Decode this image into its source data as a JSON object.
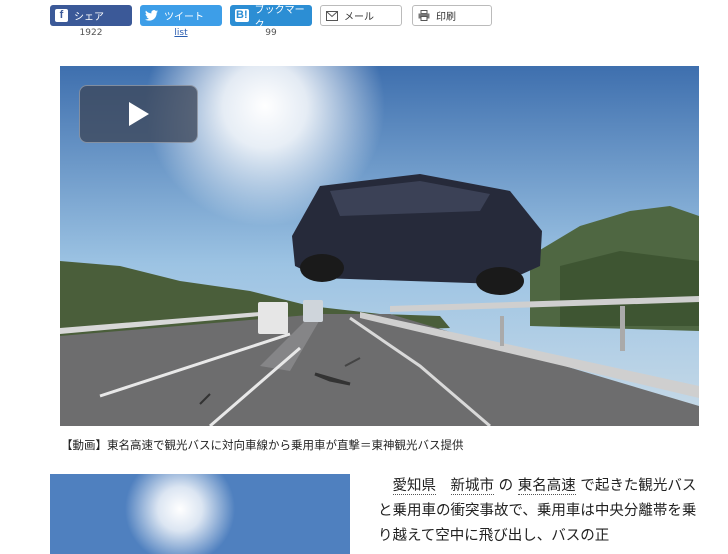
{
  "share": {
    "facebook": {
      "label": "シェア",
      "count": "1922",
      "icon": "facebook-icon"
    },
    "twitter": {
      "label": "ツイート",
      "count_link": "list",
      "icon": "twitter-bird-icon"
    },
    "hatena": {
      "label": "ブックマーク",
      "icon_text": "B!",
      "count": "99"
    },
    "mail": {
      "label": "メール",
      "icon": "mail-icon"
    },
    "print": {
      "label": "印刷",
      "icon": "printer-icon"
    }
  },
  "video": {
    "play_icon": "play-icon"
  },
  "caption": "【動画】東名高速で観光バスに対向車線から乗用車が直撃＝東神観光バス提供",
  "article": {
    "kw1": "愛知県",
    "kw2": "新城市",
    "t1": "の",
    "kw3": "東名高速",
    "t2": "で起きた観光バスと乗用車の衝突事故で、乗用車は中央分離帯を乗り越えて空中に飛び出し、バスの正"
  }
}
